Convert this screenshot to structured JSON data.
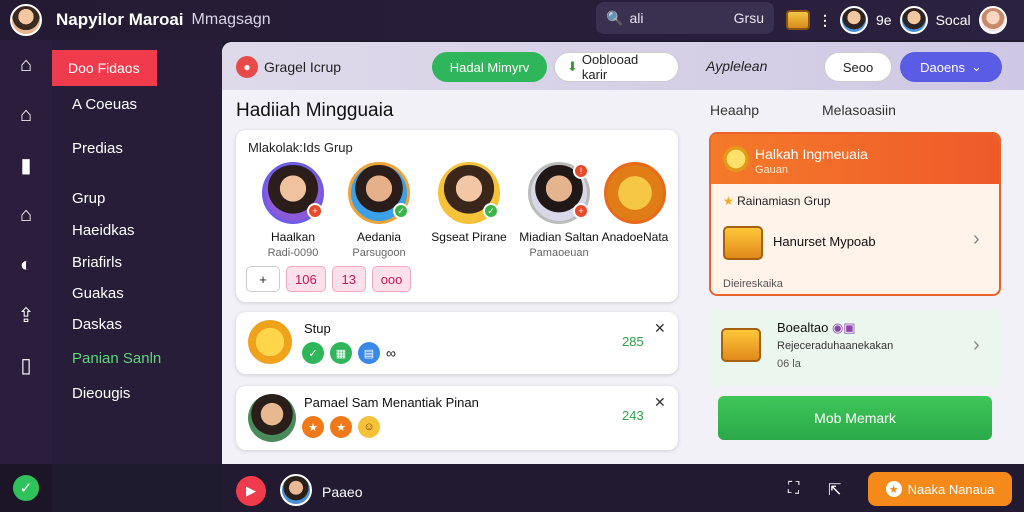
{
  "topbar": {
    "title": "Napyilor Maroai",
    "subtitle": "Mmagsagn",
    "search": {
      "placeholder": "ali",
      "scope": "Grsu"
    },
    "coins": "9e",
    "user_name": "Socal"
  },
  "sidebar": {
    "active": "Doo Fidaos",
    "items": [
      "A Coeuas",
      "Predias",
      "Grup",
      "Haeidkas",
      "Briafirls",
      "Guakas",
      "Daskas",
      "Panian Sanln",
      "Dieougis"
    ]
  },
  "header": {
    "title": "Gragel Icrup",
    "btn_green": "Hadal Mimyrv",
    "btn_white": "Ooblooad karir",
    "link": "Ayplelean",
    "btn_ghost": "Seoo",
    "btn_blue": "Daoens"
  },
  "main": {
    "section_title": "Hadiiah Mingguaia",
    "group_card": {
      "label": "Mlakolak:Ids Grup",
      "members": [
        {
          "name": "Haalkan",
          "sub": "Radi-0090"
        },
        {
          "name": "Aedania",
          "sub": "Parsugoon"
        },
        {
          "name": "Sgseat Pirane",
          "sub": ""
        },
        {
          "name": "Miadian Saltan",
          "sub": "Pamaoeuan"
        },
        {
          "name": "AnadoeNata",
          "sub": ""
        }
      ],
      "chips": [
        "+",
        "106",
        "13",
        "ooo"
      ]
    },
    "row1": {
      "title": "Stup",
      "number": "285"
    },
    "row2": {
      "title": "Pamael Sam Menantiak Pinan",
      "number": "243"
    }
  },
  "right": {
    "tabs": [
      "Heaahp",
      "Melasoasiin"
    ],
    "card1": {
      "title": "Halkah Ingmeuaia",
      "sub": "Gauan",
      "line": "Rainamiasn Grup",
      "item": "Hanurset Mypoab",
      "foot": "Dieireskaika"
    },
    "card2": {
      "title": "Boealtao",
      "sub": "Rejeceraduhaanekakan",
      "num": "06 la"
    },
    "cta": "Mob Memark"
  },
  "bottombar": {
    "name": "Paaeo",
    "cta": "Naaka Nanaua"
  },
  "colors": {
    "accent_red": "#ef3b4c",
    "accent_green": "#2fb55a",
    "accent_orange": "#f57a2a",
    "accent_blue": "#5b5ce6",
    "dark_bg": "#241a33"
  },
  "icons": [
    "home-icon",
    "house-icon",
    "chat-icon",
    "store-icon",
    "game-icon",
    "share-icon",
    "notice-icon",
    "search-icon",
    "chest-icon",
    "close-icon",
    "chevron-right-icon"
  ]
}
